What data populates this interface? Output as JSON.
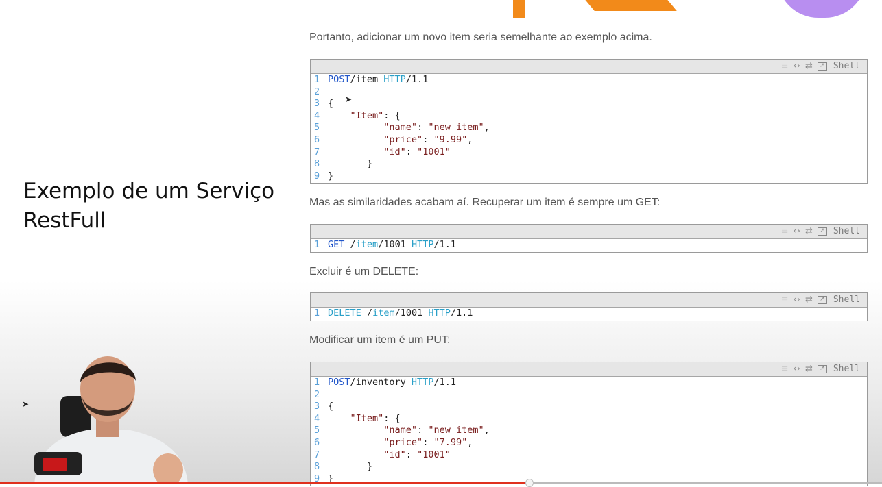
{
  "slide": {
    "title_line1": "Exemplo de um Serviço",
    "title_line2": "RestFull"
  },
  "paragraphs": {
    "p1": "Portanto, adicionar um novo item seria semelhante ao exemplo acima.",
    "p2": "Mas as similaridades acabam aí. Recuperar um item é sempre um GET:",
    "p3": "Excluir é um DELETE:",
    "p4": "Modificar um item é um PUT:"
  },
  "toolbar": {
    "lang": "Shell"
  },
  "code_blocks": {
    "post_item": [
      {
        "n": "1",
        "parts": [
          [
            "kw",
            "POST"
          ],
          [
            "",
            "/item "
          ],
          [
            "cy",
            "HTTP"
          ],
          [
            "",
            "/1.1"
          ]
        ]
      },
      {
        "n": "2",
        "parts": []
      },
      {
        "n": "3",
        "parts": [
          [
            "",
            "{"
          ]
        ]
      },
      {
        "n": "4",
        "parts": [
          [
            "",
            "    "
          ],
          [
            "str",
            "\"Item\""
          ],
          [
            "",
            ": {"
          ]
        ]
      },
      {
        "n": "5",
        "parts": [
          [
            "",
            "          "
          ],
          [
            "str",
            "\"name\""
          ],
          [
            "",
            ": "
          ],
          [
            "str",
            "\"new item\""
          ],
          [
            "",
            ","
          ]
        ]
      },
      {
        "n": "6",
        "parts": [
          [
            "",
            "          "
          ],
          [
            "str",
            "\"price\""
          ],
          [
            "",
            ": "
          ],
          [
            "str",
            "\"9.99\""
          ],
          [
            "",
            ","
          ]
        ]
      },
      {
        "n": "7",
        "parts": [
          [
            "",
            "          "
          ],
          [
            "str",
            "\"id\""
          ],
          [
            "",
            ": "
          ],
          [
            "str",
            "\"1001\""
          ]
        ]
      },
      {
        "n": "8",
        "parts": [
          [
            "",
            "       }"
          ]
        ]
      },
      {
        "n": "9",
        "parts": [
          [
            "",
            "}"
          ]
        ]
      }
    ],
    "get_item": [
      {
        "n": "1",
        "parts": [
          [
            "kw",
            "GET"
          ],
          [
            "",
            ""
          ],
          [
            "",
            "/"
          ],
          [
            "cy",
            "item"
          ],
          [
            "",
            "/1001 "
          ],
          [
            "cy",
            "HTTP"
          ],
          [
            "",
            "/1.1"
          ]
        ]
      }
    ],
    "delete_item": [
      {
        "n": "1",
        "parts": [
          [
            "cy",
            "DELETE"
          ],
          [
            "",
            ""
          ],
          [
            "",
            "/"
          ],
          [
            "cy",
            "item"
          ],
          [
            "",
            "/1001 "
          ],
          [
            "cy",
            "HTTP"
          ],
          [
            "",
            "/1.1"
          ]
        ]
      }
    ],
    "put_item": [
      {
        "n": "1",
        "parts": [
          [
            "kw",
            "POST"
          ],
          [
            "",
            "/inventory "
          ],
          [
            "cy",
            "HTTP"
          ],
          [
            "",
            "/1.1"
          ]
        ]
      },
      {
        "n": "2",
        "parts": []
      },
      {
        "n": "3",
        "parts": [
          [
            "",
            "{"
          ]
        ]
      },
      {
        "n": "4",
        "parts": [
          [
            "",
            "    "
          ],
          [
            "str",
            "\"Item\""
          ],
          [
            "",
            ": {"
          ]
        ]
      },
      {
        "n": "5",
        "parts": [
          [
            "",
            "          "
          ],
          [
            "str",
            "\"name\""
          ],
          [
            "",
            ": "
          ],
          [
            "str",
            "\"new item\""
          ],
          [
            "",
            ","
          ]
        ]
      },
      {
        "n": "6",
        "parts": [
          [
            "",
            "          "
          ],
          [
            "str",
            "\"price\""
          ],
          [
            "",
            ": "
          ],
          [
            "str",
            "\"7.99\""
          ],
          [
            "",
            ","
          ]
        ]
      },
      {
        "n": "7",
        "parts": [
          [
            "",
            "          "
          ],
          [
            "str",
            "\"id\""
          ],
          [
            "",
            ": "
          ],
          [
            "str",
            "\"1001\""
          ]
        ]
      },
      {
        "n": "8",
        "parts": [
          [
            "",
            "       }"
          ]
        ]
      },
      {
        "n": "9",
        "parts": [
          [
            "",
            "}"
          ]
        ]
      }
    ]
  },
  "video": {
    "progress": 0.6
  },
  "colors": {
    "accent_orange": "#f28a1a",
    "accent_purple": "#b88ef0",
    "progress_red": "#e0301e"
  }
}
